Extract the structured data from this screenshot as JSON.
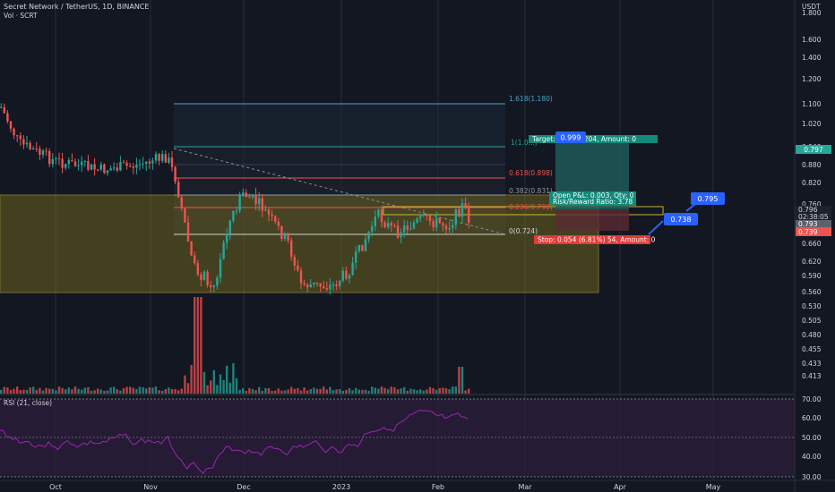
{
  "header": {
    "symbol_title": "Secret Network / TetherUS, 1D, BINANCE",
    "volume_label": "Vol · SCRT",
    "rsi_label": "RSI (21, close)"
  },
  "price_axis": {
    "currency": "USDT",
    "ticks": [
      "1.800",
      "1.600",
      "1.400",
      "1.200",
      "1.100",
      "1.020",
      "0.940",
      "0.880",
      "0.820",
      "0.760",
      "0.700",
      "0.660",
      "0.620",
      "0.590",
      "0.560",
      "0.530",
      "0.505",
      "0.480",
      "0.455",
      "0.433",
      "0.413"
    ],
    "tags": [
      {
        "text": "0.797",
        "color": "#26a69a"
      },
      {
        "text": "0.796",
        "color": "#d1d4dc"
      },
      {
        "text": "02:38:05",
        "color": "#d1d4dc"
      },
      {
        "text": "0.793",
        "color": "#5d606b"
      },
      {
        "text": "0.739",
        "color": "#ef5350"
      }
    ]
  },
  "rsi_axis": {
    "ticks": [
      "70.00",
      "60.00",
      "50.00",
      "40.00",
      "30.00"
    ]
  },
  "time_axis": {
    "ticks": [
      "Oct",
      "Nov",
      "Dec",
      "2023",
      "Feb",
      "Mar",
      "Apr",
      "May"
    ]
  },
  "fib_levels": [
    {
      "text": "1.618(1.180)",
      "color": "#4fa3c7"
    },
    {
      "text": "1(1.0...)",
      "color": "#26a69a"
    },
    {
      "text": "0.618(0.898)",
      "color": "#ef5350"
    },
    {
      "text": "0.382(0.831)",
      "color": "#9598a1"
    },
    {
      "text": "0.236(0.790)",
      "color": "#ef5350"
    },
    {
      "text": "0(0.724)",
      "color": "#d1d4dc"
    }
  ],
  "position": {
    "target_text": "Target: ...(...%) 204, Amount: 0",
    "open_pnl_text": "Open P&L: 0.003, Qty: 0",
    "rr_text": "Risk/Reward Ratio: 3.78",
    "stop_text": "Stop: 0.054 (6.81%) 54, Amount: 0"
  },
  "callouts": [
    {
      "text": "0.999"
    },
    {
      "text": "0.795"
    },
    {
      "text": "0.738"
    }
  ],
  "colors": {
    "background": "#131722",
    "up": "#26a69a",
    "down": "#ef5350",
    "zone": "#b8a72a",
    "callout": "#2962ff",
    "rsi_line": "#9c27b0"
  }
}
